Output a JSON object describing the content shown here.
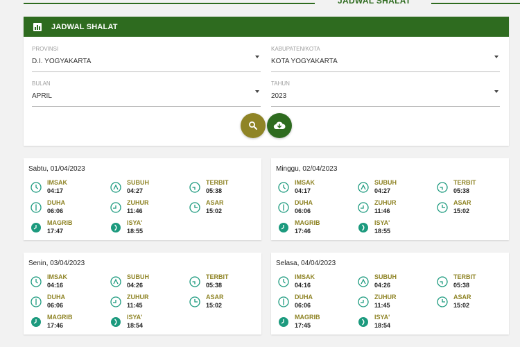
{
  "page": {
    "heading": "JADWAL SHALAT"
  },
  "panel": {
    "title": "JADWAL SHALAT",
    "fields": [
      {
        "label": "PROVINSI",
        "value": "D.I. YOGYAKARTA"
      },
      {
        "label": "KABUPATEN/KOTA",
        "value": "KOTA YOGYAKARTA"
      },
      {
        "label": "BULAN",
        "value": "APRIL"
      },
      {
        "label": "TAHUN",
        "value": "2023"
      }
    ]
  },
  "buttons": {
    "search_icon": "search-icon",
    "download_icon": "cloud-download-icon"
  },
  "colors": {
    "primary": "#2e6b1f",
    "accent": "#8f8426",
    "teal": "#1c9a7e"
  },
  "days": [
    {
      "date": "Sabtu, 01/04/2023",
      "prayers": [
        {
          "name": "IMSAK",
          "time": "04:17"
        },
        {
          "name": "SUBUH",
          "time": "04:27"
        },
        {
          "name": "TERBIT",
          "time": "05:38"
        },
        {
          "name": "DUHA",
          "time": "06:06"
        },
        {
          "name": "ZUHUR",
          "time": "11:46"
        },
        {
          "name": "ASAR",
          "time": "15:02"
        },
        {
          "name": "MAGRIB",
          "time": "17:47"
        },
        {
          "name": "ISYA'",
          "time": "18:55"
        }
      ]
    },
    {
      "date": "Minggu, 02/04/2023",
      "prayers": [
        {
          "name": "IMSAK",
          "time": "04:17"
        },
        {
          "name": "SUBUH",
          "time": "04:27"
        },
        {
          "name": "TERBIT",
          "time": "05:38"
        },
        {
          "name": "DUHA",
          "time": "06:06"
        },
        {
          "name": "ZUHUR",
          "time": "11:46"
        },
        {
          "name": "ASAR",
          "time": "15:02"
        },
        {
          "name": "MAGRIB",
          "time": "17:46"
        },
        {
          "name": "ISYA'",
          "time": "18:55"
        }
      ]
    },
    {
      "date": "Senin, 03/04/2023",
      "prayers": [
        {
          "name": "IMSAK",
          "time": "04:16"
        },
        {
          "name": "SUBUH",
          "time": "04:26"
        },
        {
          "name": "TERBIT",
          "time": "05:38"
        },
        {
          "name": "DUHA",
          "time": "06:06"
        },
        {
          "name": "ZUHUR",
          "time": "11:45"
        },
        {
          "name": "ASAR",
          "time": "15:02"
        },
        {
          "name": "MAGRIB",
          "time": "17:46"
        },
        {
          "name": "ISYA'",
          "time": "18:54"
        }
      ]
    },
    {
      "date": "Selasa, 04/04/2023",
      "prayers": [
        {
          "name": "IMSAK",
          "time": "04:16"
        },
        {
          "name": "SUBUH",
          "time": "04:26"
        },
        {
          "name": "TERBIT",
          "time": "05:38"
        },
        {
          "name": "DUHA",
          "time": "06:06"
        },
        {
          "name": "ZUHUR",
          "time": "11:45"
        },
        {
          "name": "ASAR",
          "time": "15:02"
        },
        {
          "name": "MAGRIB",
          "time": "17:45"
        },
        {
          "name": "ISYA'",
          "time": "18:54"
        }
      ]
    }
  ]
}
